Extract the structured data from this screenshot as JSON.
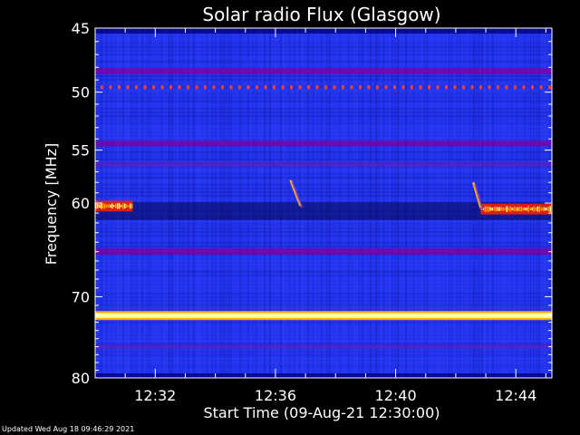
{
  "chart_data": {
    "type": "heatmap",
    "title": "Solar radio Flux (Glasgow)",
    "xlabel": "Start Time (09-Aug-21 12:30:00)",
    "ylabel": "Frequency [MHz]",
    "x_unit": "time",
    "x_range": [
      "12:30:00",
      "12:45:12"
    ],
    "x_ticks": [
      "12:32",
      "12:36",
      "12:40",
      "12:44"
    ],
    "y_range": [
      45,
      80
    ],
    "y_scale": "log",
    "y_ticks": [
      45,
      50,
      55,
      60,
      70,
      80
    ],
    "y_tick_labels": [
      "45",
      "50",
      "55",
      "60",
      "70",
      "80"
    ],
    "colormap": [
      "#000050",
      "#0000c8",
      "#2a3cff",
      "#8000a0",
      "#ff2000",
      "#ffa000",
      "#ffff80",
      "#ffffff"
    ],
    "background_color": "#2233ee",
    "band_features": [
      {
        "freq_mhz": 48.3,
        "intensity": 0.45
      },
      {
        "freq_mhz": 49.6,
        "intensity": 0.6,
        "pattern": "dotted"
      },
      {
        "freq_mhz": 54.4,
        "intensity": 0.4
      },
      {
        "freq_mhz": 56.3,
        "intensity": 0.25
      },
      {
        "freq_mhz": 60.8,
        "intensity": -0.25
      },
      {
        "freq_mhz": 65.0,
        "intensity": 0.5
      },
      {
        "freq_mhz": 72.2,
        "intensity": 1.0
      },
      {
        "freq_mhz": 76.0,
        "intensity": 0.1
      }
    ],
    "bursts": [
      {
        "time_start": "12:30:00",
        "time_end": "12:31:15",
        "freq_mhz": 60.3,
        "intensity": 0.9
      },
      {
        "time_start": "12:42:50",
        "time_end": "12:45:12",
        "freq_mhz": 60.6,
        "intensity": 0.9
      },
      {
        "time_start": "12:36:30",
        "time_end": "12:36:50",
        "freq_mhz_start": 57.8,
        "freq_mhz_end": 60.3,
        "intensity": 0.7
      },
      {
        "time_start": "12:42:35",
        "time_end": "12:42:50",
        "freq_mhz_start": 58.0,
        "freq_mhz_end": 60.5,
        "intensity": 0.7
      }
    ]
  },
  "footer": {
    "updated_text": "Updated Wed Aug 18 09:46:29 2021"
  }
}
